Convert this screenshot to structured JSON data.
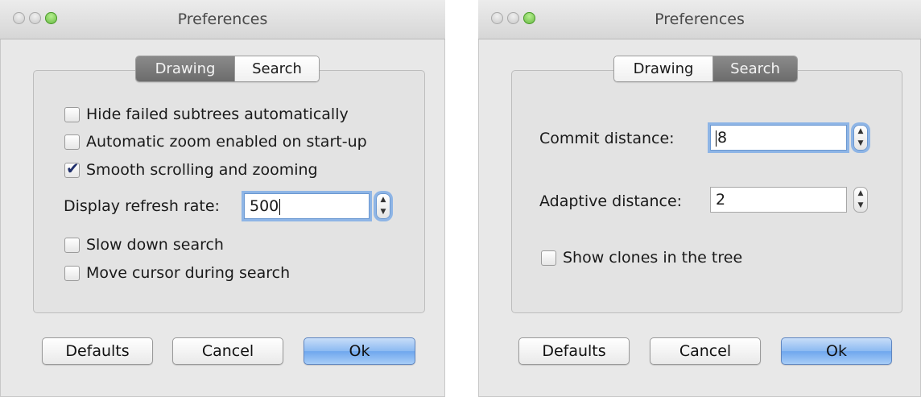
{
  "windows": [
    {
      "title": "Preferences",
      "tabs": [
        {
          "label": "Drawing",
          "selected": true
        },
        {
          "label": "Search",
          "selected": false
        }
      ],
      "checkboxes_top": [
        {
          "label": "Hide failed subtrees automatically",
          "checked": false
        },
        {
          "label": "Automatic zoom enabled on start-up",
          "checked": false
        },
        {
          "label": "Smooth scrolling and zooming",
          "checked": true
        }
      ],
      "refresh_rate": {
        "label": "Display refresh rate:",
        "value": "500"
      },
      "checkboxes_bottom": [
        {
          "label": "Slow down search",
          "checked": false
        },
        {
          "label": "Move cursor during search",
          "checked": false
        }
      ],
      "buttons": {
        "defaults": "Defaults",
        "cancel": "Cancel",
        "ok": "Ok"
      }
    },
    {
      "title": "Preferences",
      "tabs": [
        {
          "label": "Drawing",
          "selected": false
        },
        {
          "label": "Search",
          "selected": true
        }
      ],
      "commit_distance": {
        "label": "Commit distance:",
        "value": "8"
      },
      "adaptive_distance": {
        "label": "Adaptive distance:",
        "value": "2"
      },
      "checkboxes": [
        {
          "label": "Show clones in the tree",
          "checked": false
        }
      ],
      "buttons": {
        "defaults": "Defaults",
        "cancel": "Cancel",
        "ok": "Ok"
      }
    }
  ],
  "colors": {
    "window_bg": "#e8e8e8",
    "selected_tab": "#7a7a7a",
    "primary_button": "#8cbaf2",
    "focus_ring": "#8eb5e6",
    "zoom_light": "#5fb33b"
  },
  "icons": {
    "stepper_up": "▲",
    "stepper_down": "▼",
    "checkmark": "✔"
  }
}
